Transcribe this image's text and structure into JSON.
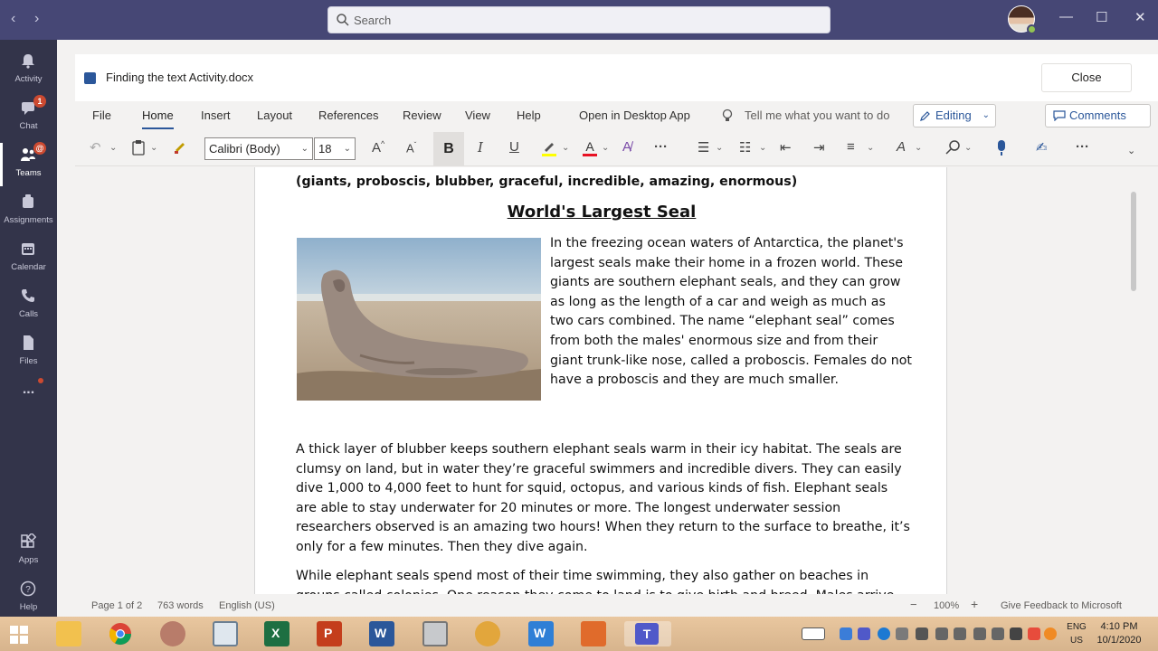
{
  "search": {
    "placeholder": "Search"
  },
  "window": {
    "minimize": "—",
    "maximize": "☐",
    "close": "✕"
  },
  "rail": {
    "items": [
      {
        "label": "Activity"
      },
      {
        "label": "Chat",
        "badge": "1"
      },
      {
        "label": "Teams",
        "badge": "@"
      },
      {
        "label": "Assignments"
      },
      {
        "label": "Calendar"
      },
      {
        "label": "Calls"
      },
      {
        "label": "Files"
      },
      {
        "label": "..."
      },
      {
        "label": "Apps"
      },
      {
        "label": "Help"
      }
    ]
  },
  "doc": {
    "filename": "Finding the text Activity.docx",
    "close_label": "Close"
  },
  "menu": {
    "items": [
      "File",
      "Home",
      "Insert",
      "Layout",
      "References",
      "Review",
      "View",
      "Help",
      "Open in Desktop App"
    ],
    "tell_me": "Tell me what you want to do",
    "editing": "Editing",
    "comments": "Comments"
  },
  "toolbar": {
    "font": "Calibri (Body)",
    "size": "18"
  },
  "content": {
    "wordlist": "(giants, proboscis, blubber, graceful, incredible, amazing, enormous)",
    "heading": "World's Largest Seal",
    "intro": "In the freezing ocean waters of Antarctica, the planet's largest seals make their home in a frozen world. These giants are southern elephant seals, and they can grow as long as the length of a car and weigh as much as two cars combined. The name “elephant seal” comes from both the males' enormous size and from their giant trunk-like nose, called a proboscis. Females do not have a proboscis and they are much smaller.",
    "para2": "A thick layer of blubber keeps southern elephant seals warm in their icy habitat. The seals are clumsy on land, but in water they’re graceful swimmers and incredible divers. They can easily dive 1,000 to 4,000 feet to hunt for squid, octopus, and various kinds of fish. Elephant seals are able to stay underwater for 20 minutes or more. The longest underwater session researchers observed is an amazing two hours! When they return to the surface to breathe, it’s only for a few minutes. Then they dive again.",
    "para3": "While elephant seals spend most of their time swimming, they also gather on beaches in groups called colonies. One reason they come to land is to give birth and breed. Males arrive"
  },
  "status": {
    "page": "Page 1 of 2",
    "words": "763 words",
    "lang": "English (US)",
    "minus": "−",
    "zoom": "100%",
    "plus": "+",
    "feedback": "Give Feedback to Microsoft"
  },
  "taskbar": {
    "lang1": "ENG",
    "lang2": "US",
    "time": "4:10 PM",
    "date": "10/1/2020"
  }
}
